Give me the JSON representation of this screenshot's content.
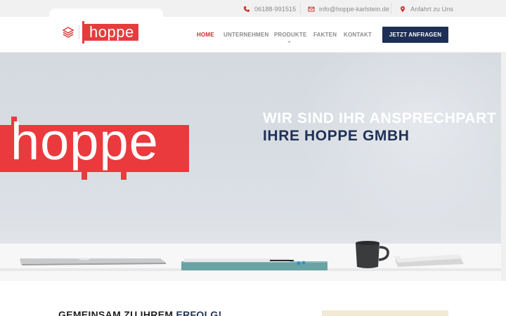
{
  "topbar": {
    "phone": "06188-991515",
    "email": "info@hoppe-karlstein.de",
    "directions": "Anfahrt zu Uns"
  },
  "header": {
    "logo_text": "hoppe",
    "nav": [
      {
        "label": "HOME",
        "active": true
      },
      {
        "label": "UNTERNEHMEN",
        "active": false
      },
      {
        "label": "PRODUKTE",
        "active": false,
        "has_dropdown": true
      },
      {
        "label": "FAKTEN",
        "active": false
      },
      {
        "label": "KONTAKT",
        "active": false
      }
    ],
    "cta_label": "JETZT ANFRAGEN"
  },
  "hero": {
    "logo_text": "hoppe",
    "headline_line1": "WIR SIND IHR ANSPRECHPART",
    "headline_line2": "IHRE HOPPE GMBH"
  },
  "section": {
    "title_part1": "GEMEINSAM ZU IHREM ",
    "title_part2": "ERFOLG!"
  },
  "colors": {
    "brand_red": "#e63c3c",
    "navy": "#1e2f55",
    "nav_active": "#c62d2d"
  },
  "icons": [
    "phone-icon",
    "mail-icon",
    "map-pin-icon",
    "layers-icon",
    "chevron-down-icon"
  ]
}
